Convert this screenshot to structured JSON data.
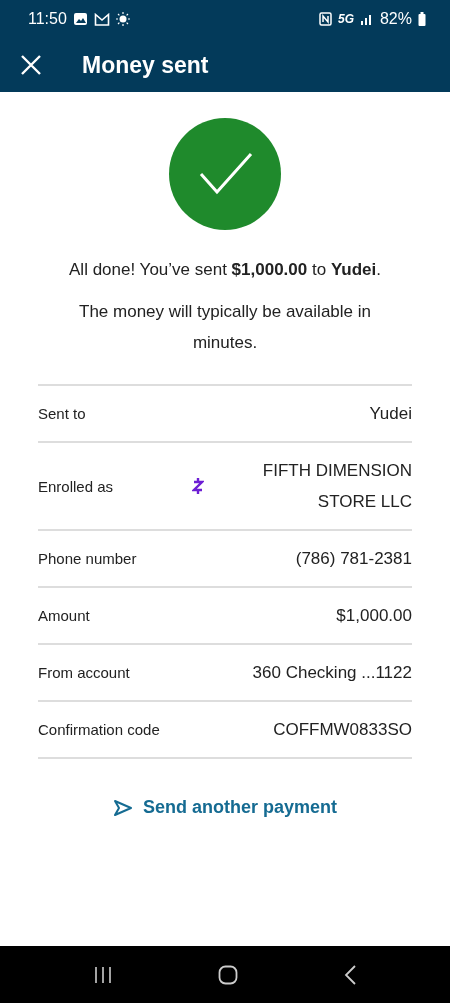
{
  "status_bar": {
    "time": "11:50",
    "battery": "82%",
    "network": "5G"
  },
  "header": {
    "title": "Money sent"
  },
  "message": "All done! You’ve sent **$1,000.00** to **Yudei**.",
  "note": "The money will typically be available in minutes.",
  "details": [
    {
      "kind": "plain",
      "label": "Sent to",
      "value": "Yudei"
    },
    {
      "kind": "with-icon",
      "label": "Enrolled as",
      "value": "FIFTH DIMENSION STORE LLC"
    },
    {
      "kind": "plain",
      "label": "Phone number",
      "value": "(786) 781-2381"
    },
    {
      "kind": "plain",
      "label": "Amount",
      "value": "$1,000.00"
    },
    {
      "kind": "plain",
      "label": "From account",
      "value": "360 Checking ...1122"
    },
    {
      "kind": "plain",
      "label": "Confirmation code",
      "value": "COFFMW0833SO"
    }
  ],
  "action": {
    "label": "Send another payment"
  }
}
